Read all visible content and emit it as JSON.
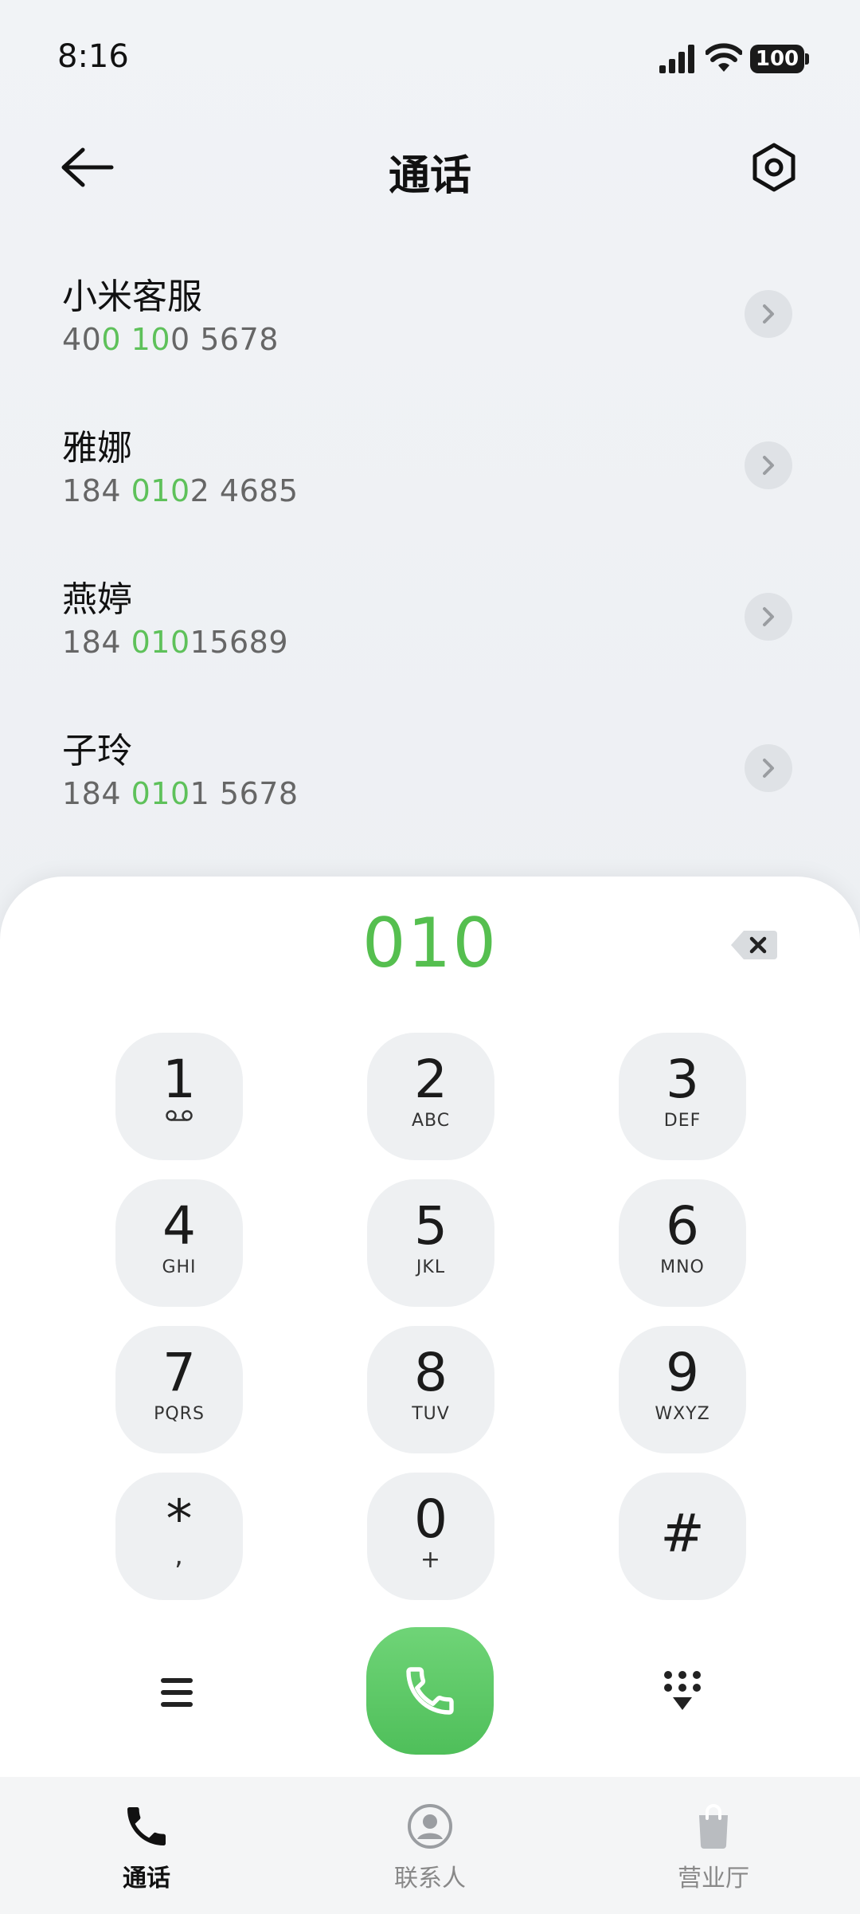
{
  "status_bar": {
    "time": "8:16",
    "battery": "100"
  },
  "header": {
    "title": "通话"
  },
  "suggestions": [
    {
      "name": "小米客服",
      "number": {
        "pre1": "40",
        "hl1": "0",
        "mid": " ",
        "hl2": "10",
        "post": "0 5678"
      }
    },
    {
      "name": "雅娜",
      "number": {
        "pre1": "184 ",
        "hl1": "010",
        "mid": "",
        "hl2": "",
        "post": "2 4685"
      }
    },
    {
      "name": "燕婷",
      "number": {
        "pre1": "184 ",
        "hl1": "010",
        "mid": "",
        "hl2": "",
        "post": "15689"
      }
    },
    {
      "name": "子玲",
      "number": {
        "pre1": "184 ",
        "hl1": "010",
        "mid": "",
        "hl2": "",
        "post": "1 5678"
      }
    }
  ],
  "dialpad": {
    "display": "010",
    "keys": [
      {
        "digit": "1",
        "letters": ""
      },
      {
        "digit": "2",
        "letters": "ABC"
      },
      {
        "digit": "3",
        "letters": "DEF"
      },
      {
        "digit": "4",
        "letters": "GHI"
      },
      {
        "digit": "5",
        "letters": "JKL"
      },
      {
        "digit": "6",
        "letters": "MNO"
      },
      {
        "digit": "7",
        "letters": "PQRS"
      },
      {
        "digit": "8",
        "letters": "TUV"
      },
      {
        "digit": "9",
        "letters": "WXYZ"
      },
      {
        "digit": "*",
        "letters": ","
      },
      {
        "digit": "0",
        "letters": "+"
      },
      {
        "digit": "#",
        "letters": ""
      }
    ]
  },
  "bottom_nav": {
    "items": [
      {
        "label": "通话",
        "icon": "phone-icon",
        "active": true
      },
      {
        "label": "联系人",
        "icon": "contacts-icon",
        "active": false
      },
      {
        "label": "营业厅",
        "icon": "shopping-bag-icon",
        "active": false
      }
    ]
  },
  "colors": {
    "accent_green": "#55bf4f",
    "call_green": "#4fbf5a"
  }
}
